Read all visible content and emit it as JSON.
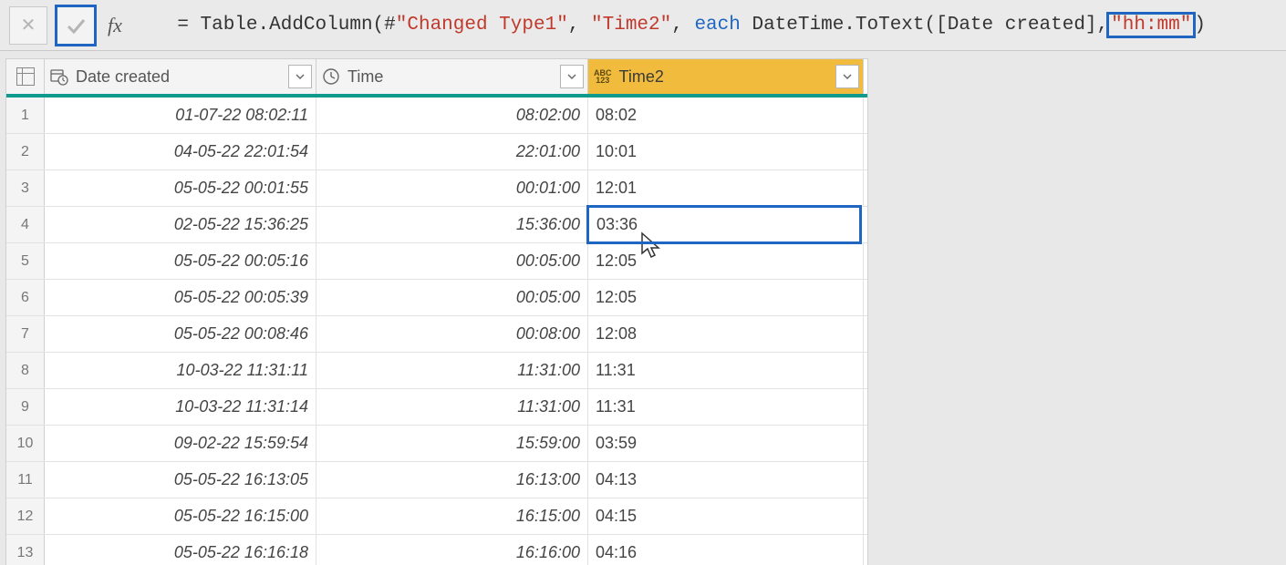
{
  "formula_bar": {
    "cancel_label": "✕",
    "fx_label": "fx",
    "prefix": "= Table.AddColumn(#",
    "str1": "\"Changed Type1\"",
    "sep1": ", ",
    "str2": "\"Time2\"",
    "sep2": ", ",
    "kw": "each",
    "mid": " DateTime.ToText([Date created],",
    "str3": "\"hh:mm\"",
    "suffix": ")"
  },
  "columns": {
    "date_created": {
      "label": "Date created",
      "type_icon": "datetime"
    },
    "time": {
      "label": "Time",
      "type_icon": "time"
    },
    "time2": {
      "label": "Time2",
      "type_icon": "any",
      "active": true
    }
  },
  "rows": [
    {
      "n": "1",
      "date": "01-07-22 08:02:11",
      "time": "08:02:00",
      "time2": "08:02"
    },
    {
      "n": "2",
      "date": "04-05-22 22:01:54",
      "time": "22:01:00",
      "time2": "10:01"
    },
    {
      "n": "3",
      "date": "05-05-22 00:01:55",
      "time": "00:01:00",
      "time2": "12:01"
    },
    {
      "n": "4",
      "date": "02-05-22 15:36:25",
      "time": "15:36:00",
      "time2": "03:36",
      "selected": true
    },
    {
      "n": "5",
      "date": "05-05-22 00:05:16",
      "time": "00:05:00",
      "time2": "12:05"
    },
    {
      "n": "6",
      "date": "05-05-22 00:05:39",
      "time": "00:05:00",
      "time2": "12:05"
    },
    {
      "n": "7",
      "date": "05-05-22 00:08:46",
      "time": "00:08:00",
      "time2": "12:08"
    },
    {
      "n": "8",
      "date": "10-03-22 11:31:11",
      "time": "11:31:00",
      "time2": "11:31"
    },
    {
      "n": "9",
      "date": "10-03-22 11:31:14",
      "time": "11:31:00",
      "time2": "11:31"
    },
    {
      "n": "10",
      "date": "09-02-22 15:59:54",
      "time": "15:59:00",
      "time2": "03:59"
    },
    {
      "n": "11",
      "date": "05-05-22 16:13:05",
      "time": "16:13:00",
      "time2": "04:13"
    },
    {
      "n": "12",
      "date": "05-05-22 16:15:00",
      "time": "16:15:00",
      "time2": "04:15"
    },
    {
      "n": "13",
      "date": "05-05-22 16:16:18",
      "time": "16:16:00",
      "time2": "04:16"
    }
  ],
  "icons": {
    "abc123_top": "ABC",
    "abc123_bot": "123"
  }
}
